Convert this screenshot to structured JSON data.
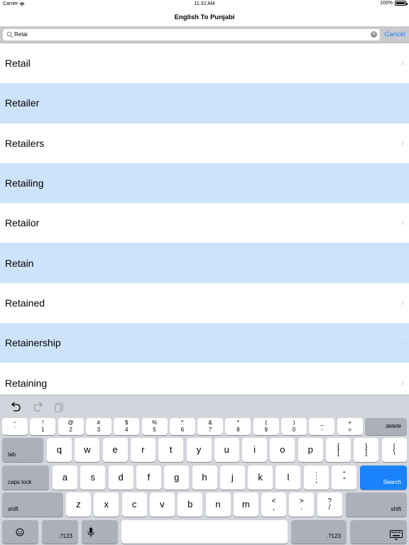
{
  "status": {
    "carrier": "Carrier",
    "time": "11:32 AM",
    "battery": "100%"
  },
  "nav": {
    "title": "English To Punjabi"
  },
  "search": {
    "value": "Retai",
    "cancel": "Cancel"
  },
  "results": [
    "Retail",
    "Retailer",
    "Retailers",
    "Retailing",
    "Retailor",
    "Retain",
    "Retained",
    "Retainership",
    "Retaining"
  ],
  "keyboard": {
    "row1": [
      {
        "top": "~",
        "bottom": "`"
      },
      {
        "top": "!",
        "bottom": "1"
      },
      {
        "top": "@",
        "bottom": "2"
      },
      {
        "top": "#",
        "bottom": "3"
      },
      {
        "top": "$",
        "bottom": "4"
      },
      {
        "top": "%",
        "bottom": "5"
      },
      {
        "top": "^",
        "bottom": "6"
      },
      {
        "top": "&",
        "bottom": "7"
      },
      {
        "top": "*",
        "bottom": "8"
      },
      {
        "top": "(",
        "bottom": "9"
      },
      {
        "top": ")",
        "bottom": "0"
      },
      {
        "top": "_",
        "bottom": "-"
      },
      {
        "top": "+",
        "bottom": "="
      }
    ],
    "delete": "delete",
    "tab": "tab",
    "row2": [
      "q",
      "w",
      "e",
      "r",
      "t",
      "y",
      "u",
      "i",
      "o",
      "p"
    ],
    "row2_extra": [
      {
        "top": "{",
        "bottom": "["
      },
      {
        "top": "}",
        "bottom": "]"
      },
      {
        "top": "|",
        "bottom": "\\"
      }
    ],
    "caps": "caps lock",
    "row3": [
      "a",
      "s",
      "d",
      "f",
      "g",
      "h",
      "j",
      "k",
      "l"
    ],
    "row3_extra": [
      {
        "top": ":",
        "bottom": ";"
      },
      {
        "top": "“",
        "bottom": "”"
      }
    ],
    "search_key": "Search",
    "shift": "shift",
    "row4": [
      "z",
      "x",
      "c",
      "v",
      "b",
      "n",
      "m"
    ],
    "row4_extra": [
      {
        "top": "<",
        "bottom": ","
      },
      {
        "top": ">",
        "bottom": "."
      },
      {
        "top": "?",
        "bottom": "/"
      }
    ],
    "numbers": ".?123",
    "emoji_icon": "emoji-icon",
    "mic_icon": "microphone-icon",
    "hide_icon": "keyboard-dismiss-icon",
    "undo_icon": "undo-icon",
    "redo_icon": "redo-icon",
    "paste_icon": "paste-icon"
  }
}
